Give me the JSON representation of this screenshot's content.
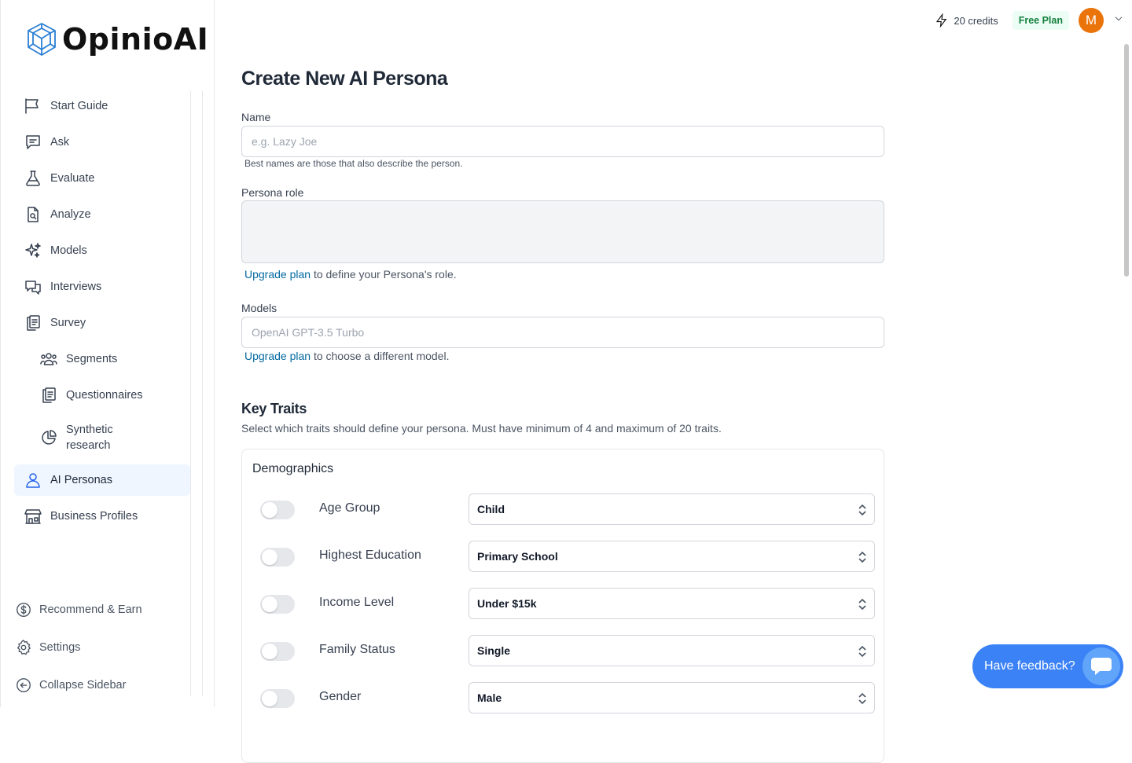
{
  "app": {
    "name": "OpinioAI"
  },
  "sidebar": {
    "items": [
      {
        "label": "Start Guide",
        "icon": "flag-icon"
      },
      {
        "label": "Ask",
        "icon": "chat-icon"
      },
      {
        "label": "Evaluate",
        "icon": "flask-icon"
      },
      {
        "label": "Analyze",
        "icon": "doc-search-icon"
      },
      {
        "label": "Models",
        "icon": "sparkles-icon"
      },
      {
        "label": "Interviews",
        "icon": "chat-bubbles-icon"
      },
      {
        "label": "Survey",
        "icon": "clipboard-icon"
      },
      {
        "label": "Segments",
        "icon": "users-icon"
      },
      {
        "label": "Questionnaires",
        "icon": "clipboard-icon"
      },
      {
        "label": "Synthetic research",
        "icon": "pie-chart-icon"
      },
      {
        "label": "AI Personas",
        "icon": "user-icon"
      },
      {
        "label": "Business Profiles",
        "icon": "building-icon"
      }
    ],
    "bottom": [
      {
        "label": "Recommend & Earn",
        "icon": "dollar-icon"
      },
      {
        "label": "Settings",
        "icon": "gear-icon"
      },
      {
        "label": "Collapse Sidebar",
        "icon": "arrow-left-circle-icon"
      }
    ]
  },
  "topbar": {
    "credits": "20 credits",
    "plan": "Free Plan",
    "avatar_initial": "M"
  },
  "form": {
    "title": "Create New AI Persona",
    "name_label": "Name",
    "name_placeholder": "e.g. Lazy Joe",
    "name_hint": "Best names are those that also describe the person.",
    "role_label": "Persona role",
    "role_upgrade_link": "Upgrade plan",
    "role_upgrade_text": " to define your Persona's role.",
    "models_label": "Models",
    "models_value": "OpenAI GPT-3.5 Turbo",
    "models_upgrade_link": "Upgrade plan",
    "models_upgrade_text": " to choose a different model."
  },
  "traits": {
    "title": "Key Traits",
    "description": "Select which traits should define your persona. Must have minimum of 4 and maximum of 20 traits.",
    "section_title": "Demographics",
    "rows": [
      {
        "label": "Age Group",
        "value": "Child",
        "enabled": false
      },
      {
        "label": "Highest Education",
        "value": "Primary School",
        "enabled": false
      },
      {
        "label": "Income Level",
        "value": "Under $15k",
        "enabled": false
      },
      {
        "label": "Family Status",
        "value": "Single",
        "enabled": false
      },
      {
        "label": "Gender",
        "value": "Male",
        "enabled": false
      }
    ]
  },
  "feedback": {
    "label": "Have feedback?"
  }
}
